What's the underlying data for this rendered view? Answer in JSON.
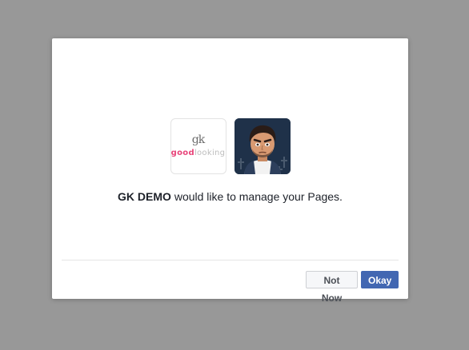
{
  "dialog": {
    "app_logo": {
      "monogram": "gk",
      "word_part1": "good",
      "word_part2": "looking"
    },
    "message": {
      "app_name": "GK DEMO",
      "text": " would like to manage your Pages."
    },
    "buttons": {
      "not_now": "Not Now",
      "okay": "Okay"
    }
  },
  "colors": {
    "overlay": "#989898",
    "primary_button": "#4267b2",
    "logo_accent": "#e8457a"
  }
}
